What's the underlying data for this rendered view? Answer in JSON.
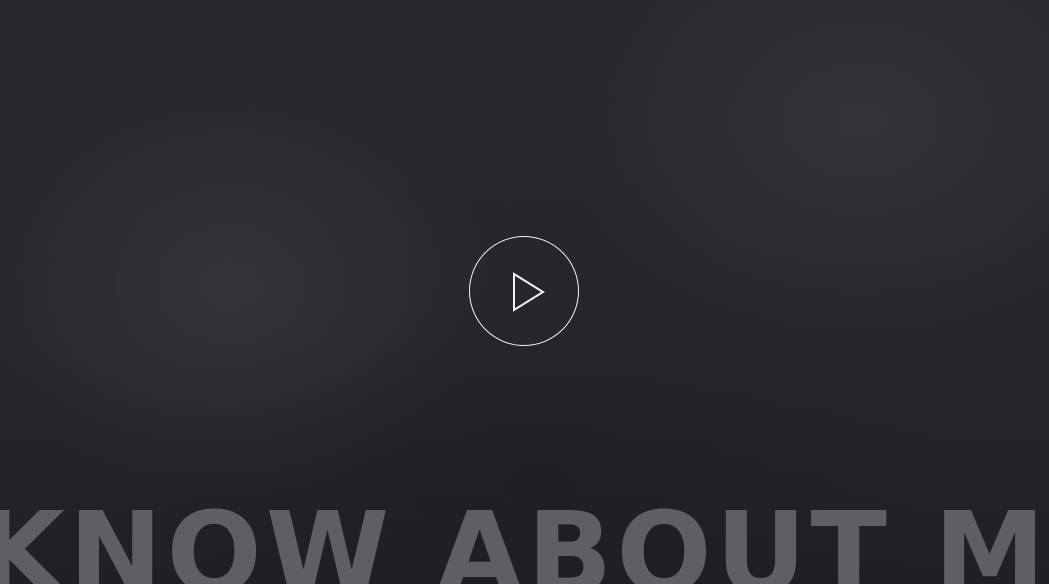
{
  "hero": {
    "play_icon": "play-icon",
    "headline": "KNOW ABOUT ME",
    "colors": {
      "background": "#25262b",
      "headline": "#5e5f64",
      "play_outline": "#f2f2f2"
    }
  }
}
